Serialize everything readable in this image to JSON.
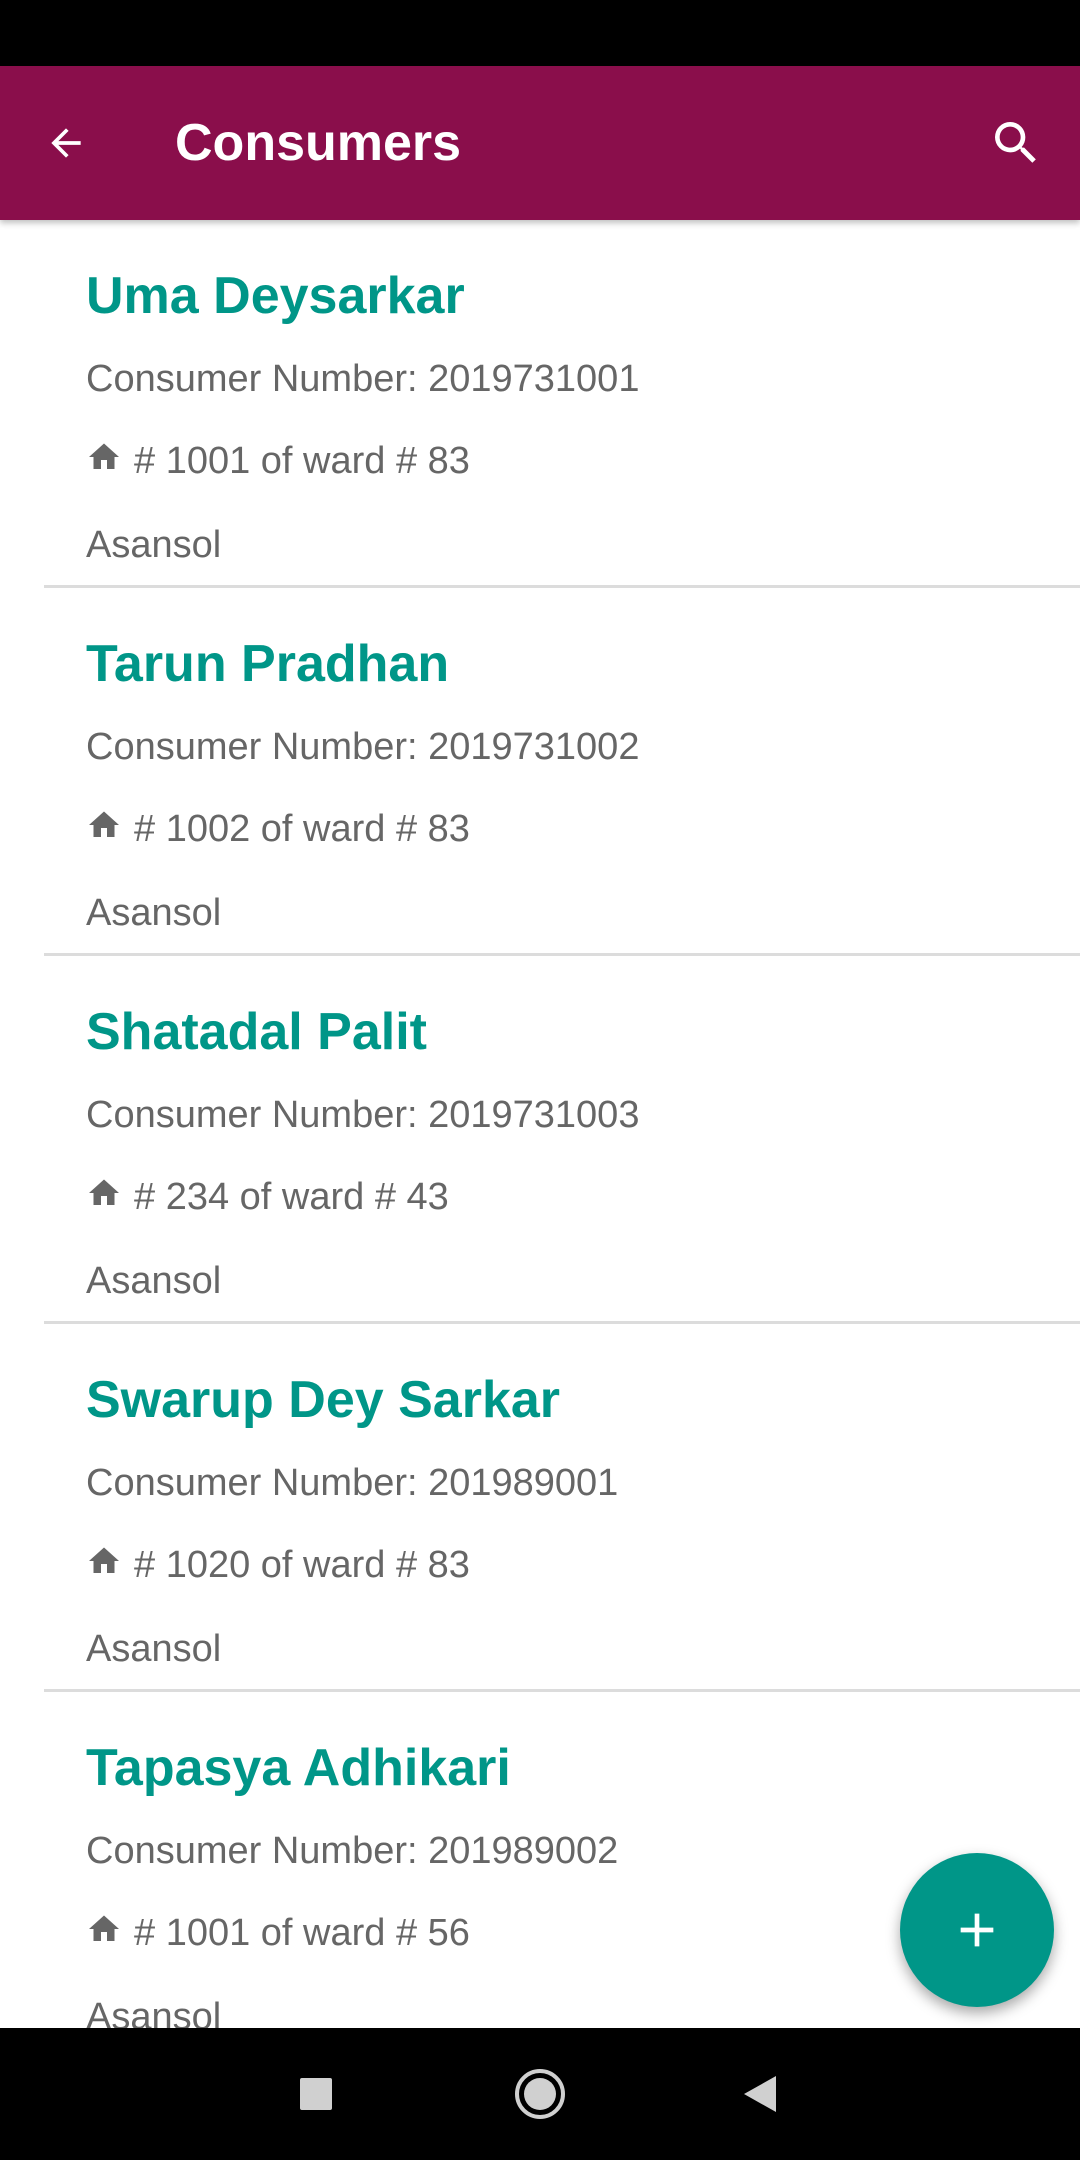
{
  "colors": {
    "primary": "#8a0e4b",
    "accent": "#009688",
    "text_secondary": "#666666",
    "divider": "#dcdcdc"
  },
  "app_bar": {
    "title": "Consumers",
    "back_icon": "arrow-left-icon",
    "search_icon": "search-icon"
  },
  "consumers": [
    {
      "name": "Uma Deysarkar",
      "consumer_number": "Consumer Number: 2019731001",
      "address": "# 1001 of ward # 83",
      "city": "Asansol"
    },
    {
      "name": "Tarun Pradhan",
      "consumer_number": "Consumer Number: 2019731002",
      "address": "# 1002 of ward # 83",
      "city": "Asansol"
    },
    {
      "name": "Shatadal Palit",
      "consumer_number": "Consumer Number: 2019731003",
      "address": "# 234 of ward # 43",
      "city": "Asansol"
    },
    {
      "name": "Swarup Dey Sarkar",
      "consumer_number": "Consumer Number: 201989001",
      "address": "# 1020 of ward # 83",
      "city": "Asansol"
    },
    {
      "name": "Tapasya Adhikari",
      "consumer_number": "Consumer Number: 201989002",
      "address": "# 1001 of ward # 56",
      "city": "Asansol"
    }
  ],
  "fab": {
    "icon": "plus-icon"
  },
  "nav_bar": {
    "recents_icon": "square-icon",
    "home_icon": "circle-icon",
    "back_icon": "triangle-back-icon"
  }
}
